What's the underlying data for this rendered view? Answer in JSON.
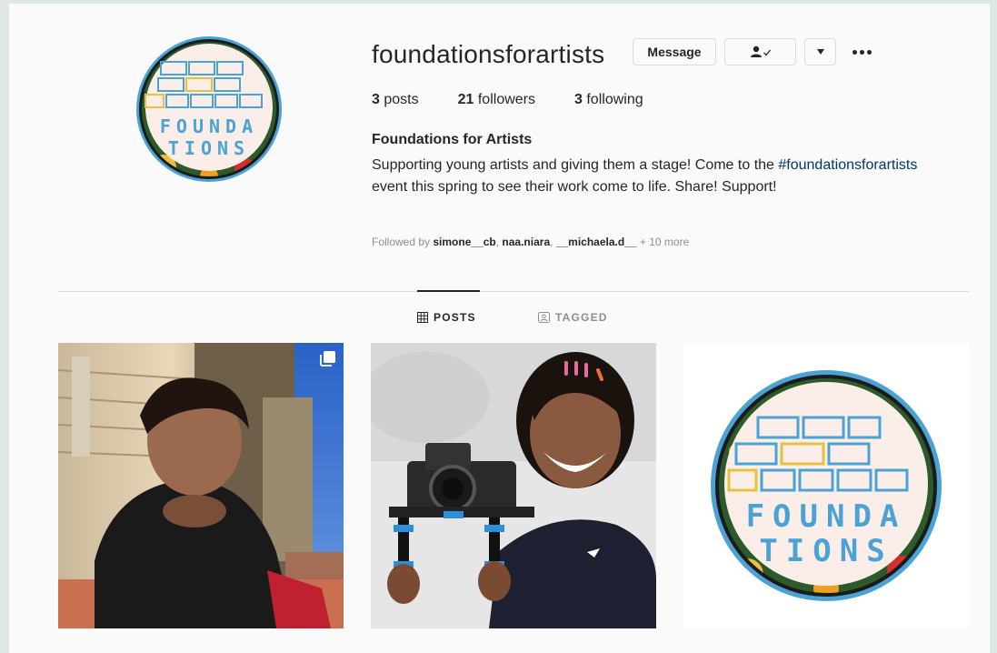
{
  "profile": {
    "username": "foundationsforartists",
    "message_label": "Message",
    "posts_count": "3",
    "posts_label": "posts",
    "followers_count": "21",
    "followers_label": "followers",
    "following_count": "3",
    "following_label": "following",
    "full_name": "Foundations for Artists",
    "bio_part1": "Supporting young artists and giving them a stage! Come to the ",
    "bio_hashtag": "#foundationsforartists",
    "bio_part2": " event this spring to see their work come to life. Share! Support!",
    "followed_by_prefix": "Followed by ",
    "followed_by_users": [
      "simone__cb",
      "naa.niara",
      "__michaela.d__"
    ],
    "followed_by_suffix": "+ 10 more"
  },
  "logo": {
    "line1": "FOUNDA",
    "line2": "TIONS"
  },
  "tabs": [
    {
      "label": "POSTS",
      "icon": "grid-icon",
      "active": true
    },
    {
      "label": "TAGGED",
      "icon": "tagged-icon",
      "active": false
    }
  ],
  "colors": {
    "logo_blue": "#4aa3d4",
    "logo_yellow": "#e8c040",
    "logo_bg": "#fbeee8",
    "link": "#00376b"
  }
}
